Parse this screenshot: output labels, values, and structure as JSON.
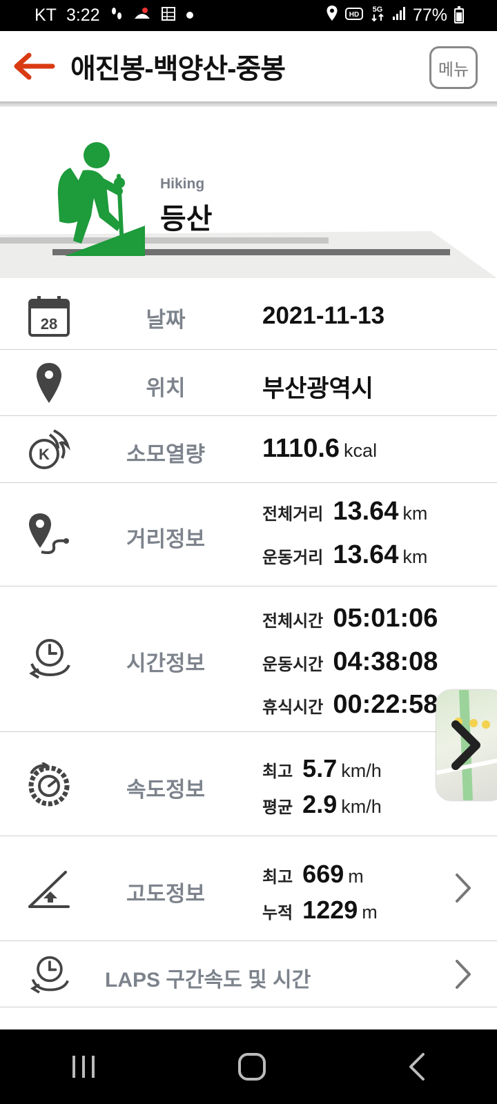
{
  "status_bar": {
    "carrier": "KT",
    "time": "3:22",
    "battery": "77%",
    "icons": [
      "footsteps-icon",
      "hiking-app-icon",
      "gallery-icon",
      "dot-icon",
      "location-icon",
      "hd-icon",
      "5g-icon",
      "signal-icon",
      "battery-icon"
    ]
  },
  "header": {
    "title": "애진봉-백양산-중봉",
    "menu_label": "메뉴",
    "accent_color": "#d93a12"
  },
  "activity": {
    "en": "Hiking",
    "ko": "등산",
    "icon_color": "#1e9b3b"
  },
  "rows": {
    "date": {
      "label": "날짜",
      "value": "2021-11-13",
      "calendar_day": "28"
    },
    "location": {
      "label": "위치",
      "value": "부산광역시"
    },
    "calories": {
      "label": "소모열량",
      "value": "1110.6",
      "unit": "kcal",
      "icon_letter": "K"
    },
    "distance": {
      "label": "거리정보",
      "total_label": "전체거리",
      "total_value": "13.64",
      "total_unit": "km",
      "moving_label": "운동거리",
      "moving_value": "13.64",
      "moving_unit": "km"
    },
    "time": {
      "label": "시간정보",
      "total_label": "전체시간",
      "total_value": "05:01:06",
      "moving_label": "운동시간",
      "moving_value": "04:38:08",
      "rest_label": "휴식시간",
      "rest_value": "00:22:58"
    },
    "speed": {
      "label": "속도정보",
      "max_label": "최고",
      "max_value": "5.7",
      "max_unit": "km/h",
      "avg_label": "평균",
      "avg_value": "2.9",
      "avg_unit": "km/h"
    },
    "altitude": {
      "label": "고도정보",
      "max_label": "최고",
      "max_value": "669",
      "max_unit": "m",
      "cum_label": "누적",
      "cum_value": "1229",
      "cum_unit": "m"
    },
    "laps": {
      "label": "LAPS 구간속도 및 시간"
    }
  }
}
